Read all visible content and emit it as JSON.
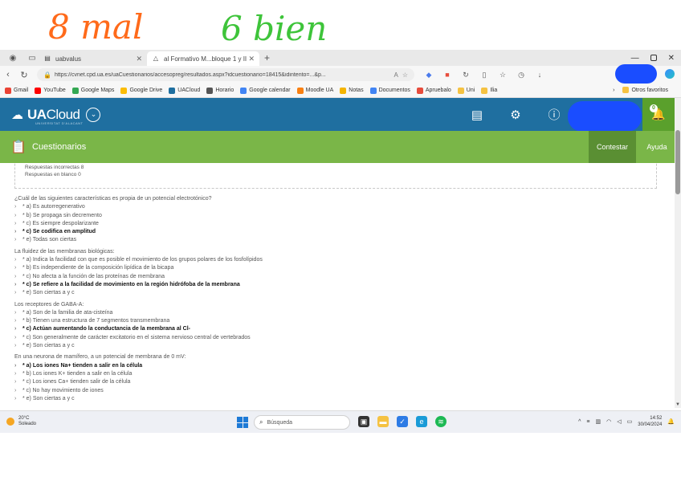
{
  "annotation": {
    "left": "8 mal",
    "right": "6 bien"
  },
  "browser": {
    "tabs": [
      {
        "label": "uabvalus"
      },
      {
        "label": "al Formativo M...bloque 1 y II"
      }
    ],
    "url": "https://cvnet.cpd.ua.es/uaCuestionarios/accesopreg/resultados.aspx?idcuestionario=18415&idintento=...&p...",
    "bookmarks": [
      "Gmail",
      "YouTube",
      "Google Maps",
      "Google Drive",
      "UACloud",
      "Horario",
      "Google calendar",
      "Moodle UA",
      "Notas",
      "Documentos",
      "Apruebalo",
      "Uni",
      "Ilia"
    ],
    "other_favorites": "Otros favoritos"
  },
  "ua": {
    "name_bold": "UA",
    "name_thin": "Cloud",
    "subtitle": "UNIVERSITAT D'ALACANT",
    "badge": "0"
  },
  "section": {
    "title": "Cuestionarios",
    "contestar": "Contestar",
    "ayuda": "Ayuda"
  },
  "summary": {
    "line1": "Respuestas incorrectas 8",
    "line2": "Respuestas en blanco 0"
  },
  "questions": [
    {
      "text": "¿Cuál de las siguientes características es propia de un potencial electrotónico?",
      "options": [
        {
          "text": "* a) Es autorregenerativo",
          "bold": false
        },
        {
          "text": "* b) Se propaga sin decremento",
          "bold": false
        },
        {
          "text": "* c) Es siempre despolarizante",
          "bold": false
        },
        {
          "text": "* c) Se codifica en amplitud",
          "bold": true
        },
        {
          "text": "* e) Todas son ciertas",
          "bold": false
        }
      ]
    },
    {
      "text": "La fluidez de las membranas biológicas:",
      "options": [
        {
          "text": "* a) Indica la facilidad con que es posible el movimiento de los grupos polares de los fosfolípidos",
          "bold": false
        },
        {
          "text": "* b) Es independiente de la composición lipídica de la bicapa",
          "bold": false
        },
        {
          "text": "* c) No afecta a la función de las proteínas de membrana",
          "bold": false
        },
        {
          "text": "* c) Se refiere a la facilidad de movimiento en la región hidrófoba de la membrana",
          "bold": true
        },
        {
          "text": "* e) Son ciertas a y c",
          "bold": false
        }
      ]
    },
    {
      "text": "Los receptores de GABA-A:",
      "options": [
        {
          "text": "* a) Son de la familia de ata-cisteína",
          "bold": false
        },
        {
          "text": "* b) Tienen una estructura de 7 segmentos transmembrana",
          "bold": false
        },
        {
          "text": "* c) Actúan aumentando la conductancia de la membrana al Cl-",
          "bold": true
        },
        {
          "text": "* c) Son generalmente de carácter excitatorio en el sistema nervioso central de vertebrados",
          "bold": false
        },
        {
          "text": "* e) Son ciertas a y c",
          "bold": false
        }
      ]
    },
    {
      "text": "En una neurona de mamífero, a un potencial de membrana de 0 mV:",
      "options": [
        {
          "text": "* a) Los iones Na+ tienden a salir en la célula",
          "bold": true
        },
        {
          "text": "* b) Los iones K+ tienden a salir en la célula",
          "bold": false
        },
        {
          "text": "* c) Los iones Ca+ tienden salir de la célula",
          "bold": false
        },
        {
          "text": "* c) No hay movimiento de iones",
          "bold": false
        },
        {
          "text": "* e) Son ciertas a y c",
          "bold": false
        }
      ]
    }
  ],
  "taskbar": {
    "weather_temp": "20°C",
    "weather_desc": "Soleado",
    "search": "Búsqueda",
    "time": "14:52",
    "date": "30/04/2024"
  },
  "colors": {
    "header_blue": "#1f6fa0",
    "section_green": "#7ab648",
    "contestar_green": "#5a8f33",
    "handwriting_orange": "#ff6a1a",
    "handwriting_green": "#3ec43a",
    "redaction_blue": "#1a4dff"
  }
}
